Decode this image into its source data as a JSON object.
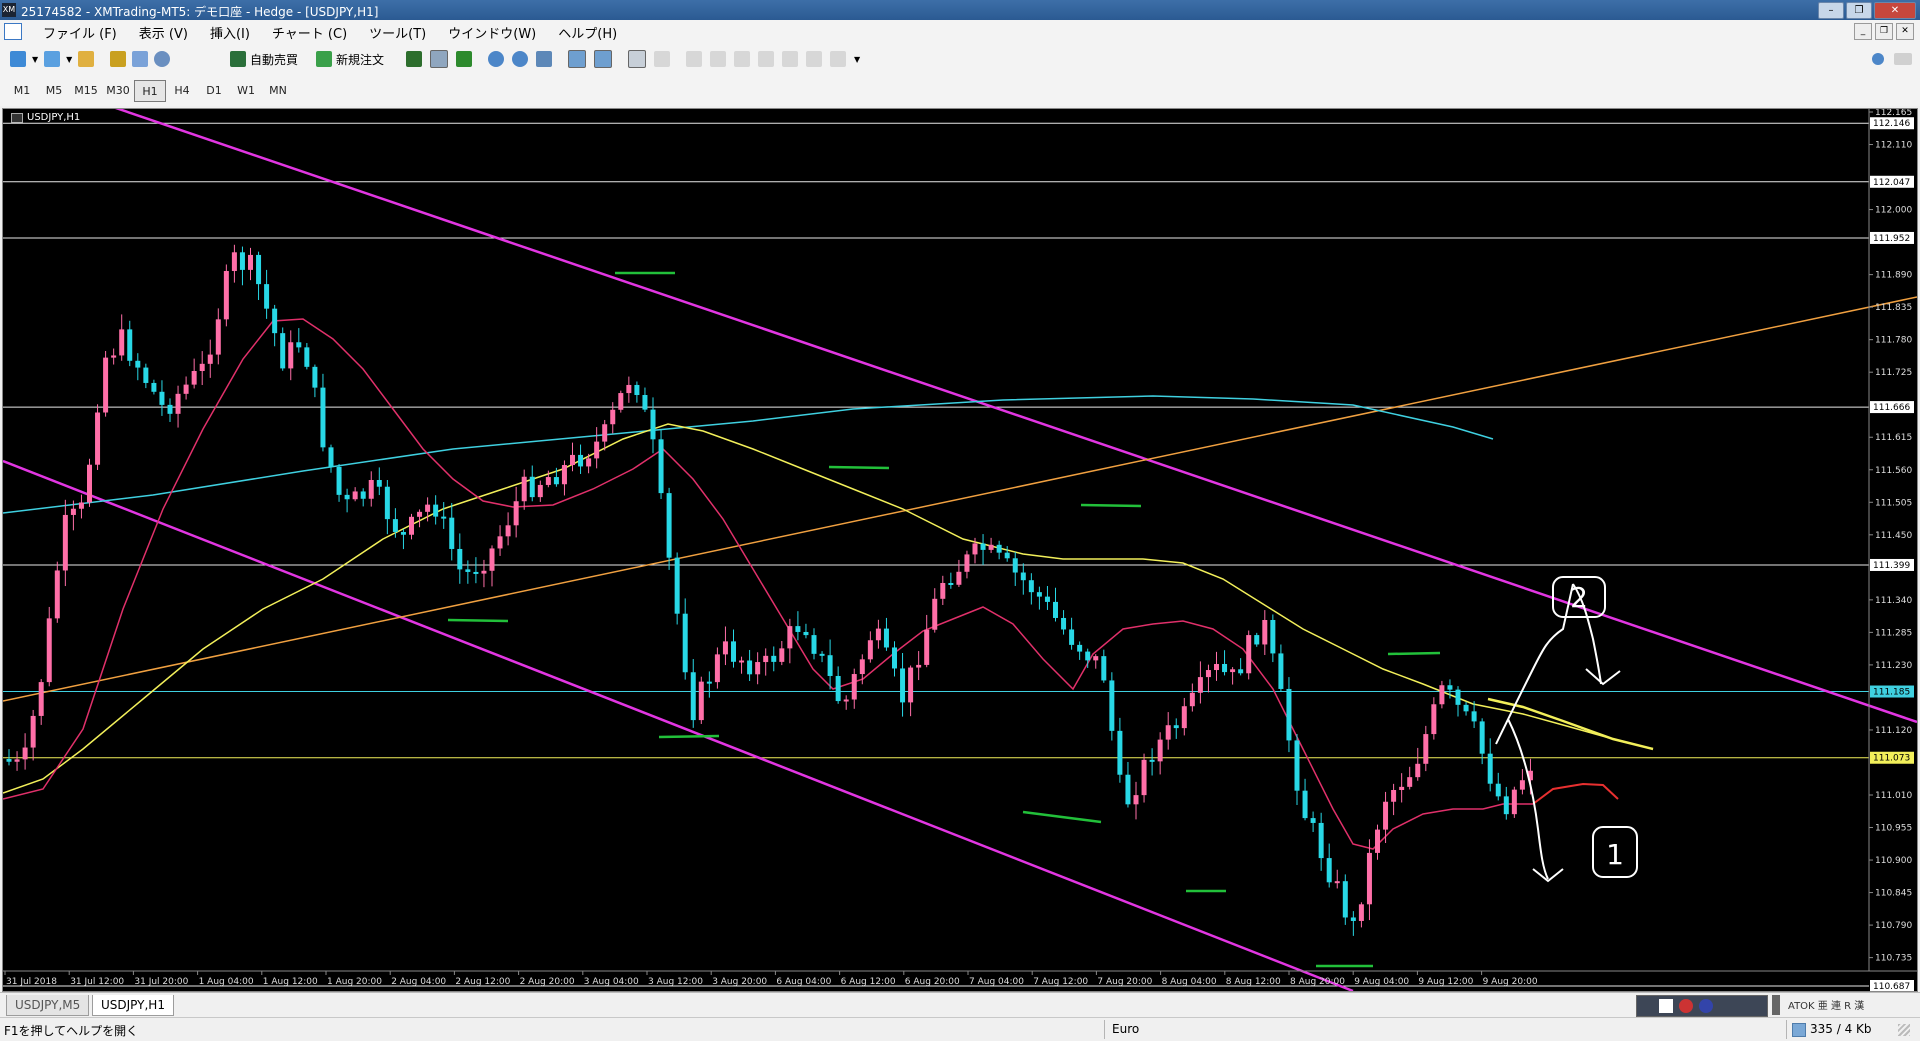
{
  "window": {
    "title": "25174582 - XMTrading-MT5: デモ口座 - Hedge - [USDJPY,H1]",
    "icon_text": "XM"
  },
  "menu": {
    "items": [
      "ファイル (F)",
      "表示 (V)",
      "挿入(I)",
      "チャート (C)",
      "ツール(T)",
      "ウインドウ(W)",
      "ヘルプ(H)"
    ]
  },
  "toolbar": {
    "auto_trade_label": "自動売買",
    "new_order_label": "新規注文"
  },
  "timeframes": {
    "items": [
      "M1",
      "M5",
      "M15",
      "M30",
      "H1",
      "H4",
      "D1",
      "W1",
      "MN"
    ],
    "active": "H1"
  },
  "chart": {
    "symbol_label": "USDJPY,H1",
    "price_labels": [
      "112.165",
      "112.110",
      "112.000",
      "111.890",
      "111.835",
      "111.780",
      "111.725",
      "111.615",
      "111.560",
      "111.505",
      "111.450",
      "111.340",
      "111.285",
      "111.230",
      "111.120",
      "111.010",
      "110.955",
      "110.900",
      "110.845",
      "110.790",
      "110.735"
    ],
    "hline_labels": [
      "112.146",
      "112.047",
      "111.952",
      "111.666",
      "111.399",
      "111.185",
      "111.073",
      "110.687"
    ],
    "time_labels": [
      "31 Jul 2018",
      "31 Jul 12:00",
      "31 Jul 20:00",
      "1 Aug 04:00",
      "1 Aug 12:00",
      "1 Aug 20:00",
      "2 Aug 04:00",
      "2 Aug 12:00",
      "2 Aug 20:00",
      "3 Aug 04:00",
      "3 Aug 12:00",
      "3 Aug 20:00",
      "6 Aug 04:00",
      "6 Aug 12:00",
      "6 Aug 20:00",
      "7 Aug 04:00",
      "7 Aug 12:00",
      "7 Aug 20:00",
      "8 Aug 04:00",
      "8 Aug 12:00",
      "8 Aug 20:00",
      "9 Aug 04:00",
      "9 Aug 12:00",
      "9 Aug 20:00"
    ],
    "annotations": [
      "2",
      "1"
    ],
    "colors": {
      "bull": "#ff6fa8",
      "bear": "#28d8e6",
      "ma_fast": "#e0306a",
      "ma_mid": "#f2ef5a",
      "ma_slow": "#3fd0e0",
      "channel": "#e236e2",
      "trend": "#f0a040"
    }
  },
  "tabs": {
    "items": [
      "USDJPY,M5",
      "USDJPY,H1"
    ],
    "active": "USDJPY,H1"
  },
  "status": {
    "help": "F1を押してヘルプを開く",
    "profile": "Euro",
    "traffic": "335 / 4 Kb",
    "ime": "ATOK 亜 連 R 漢"
  }
}
